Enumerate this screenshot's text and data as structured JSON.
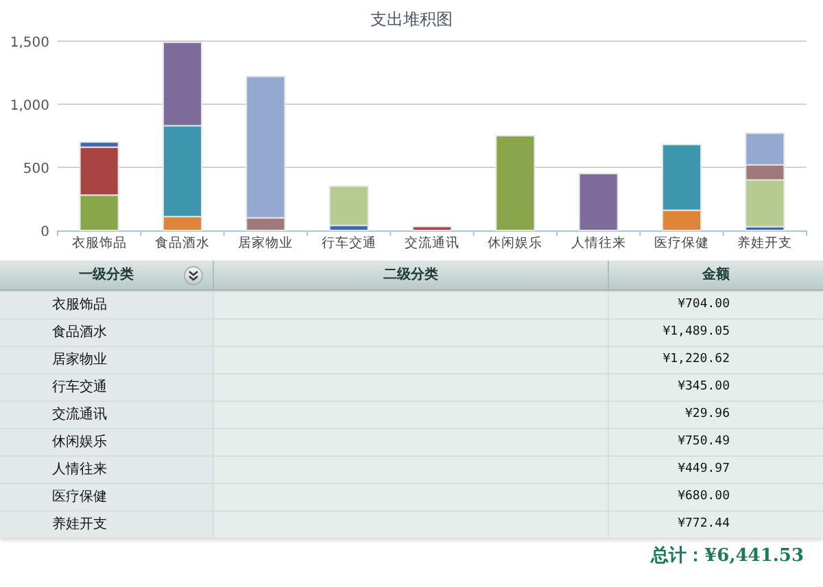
{
  "chart": {
    "chart_data": {
      "type": "bar",
      "title": "支出堆积图",
      "stacked": true,
      "categories": [
        "衣服饰品",
        "食品酒水",
        "居家物业",
        "行车交通",
        "交流通讯",
        "休闲娱乐",
        "人情往来",
        "医疗保健",
        "养娃开支"
      ],
      "ylim": [
        0,
        1500
      ],
      "yticks": [
        {
          "value": 0,
          "label": "0"
        },
        {
          "value": 500,
          "label": "500"
        },
        {
          "value": 1000,
          "label": "1,000"
        },
        {
          "value": 1500,
          "label": "1,500"
        }
      ],
      "series": [
        {
          "color": "#8aa64a",
          "values": [
            280,
            0,
            0,
            0,
            0,
            750,
            0,
            0,
            0
          ]
        },
        {
          "color": "#a84444",
          "values": [
            380,
            0,
            0,
            0,
            30,
            0,
            0,
            0,
            0
          ]
        },
        {
          "color": "#4067a8",
          "values": [
            40,
            0,
            0,
            40,
            0,
            0,
            0,
            0,
            30
          ]
        },
        {
          "color": "#b5cb8f",
          "values": [
            0,
            0,
            0,
            310,
            0,
            0,
            0,
            0,
            370
          ]
        },
        {
          "color": "#a07a7a",
          "values": [
            0,
            0,
            100,
            0,
            0,
            0,
            0,
            0,
            120
          ]
        },
        {
          "color": "#93a9cf",
          "values": [
            0,
            0,
            1120,
            0,
            0,
            0,
            0,
            0,
            250
          ]
        },
        {
          "color": "#de853a",
          "values": [
            0,
            110,
            0,
            0,
            0,
            0,
            0,
            160,
            0
          ]
        },
        {
          "color": "#3d96ad",
          "values": [
            0,
            720,
            0,
            0,
            0,
            0,
            0,
            520,
            0
          ]
        },
        {
          "color": "#7f6a9c",
          "values": [
            0,
            660,
            0,
            0,
            0,
            0,
            450,
            0,
            0
          ]
        }
      ]
    }
  },
  "table": {
    "columns": [
      "一级分类",
      "二级分类",
      "金额"
    ],
    "rows": [
      {
        "level1": "衣服饰品",
        "amount": "¥704.00"
      },
      {
        "level1": "食品酒水",
        "amount": "¥1,489.05"
      },
      {
        "level1": "居家物业",
        "amount": "¥1,220.62"
      },
      {
        "level1": "行车交通",
        "amount": "¥345.00"
      },
      {
        "level1": "交流通讯",
        "amount": "¥29.96"
      },
      {
        "level1": "休闲娱乐",
        "amount": "¥750.49"
      },
      {
        "level1": "人情往来",
        "amount": "¥449.97"
      },
      {
        "level1": "医疗保健",
        "amount": "¥680.00"
      },
      {
        "level1": "养娃开支",
        "amount": "¥772.44"
      }
    ]
  },
  "total": "总计：¥6,441.53"
}
